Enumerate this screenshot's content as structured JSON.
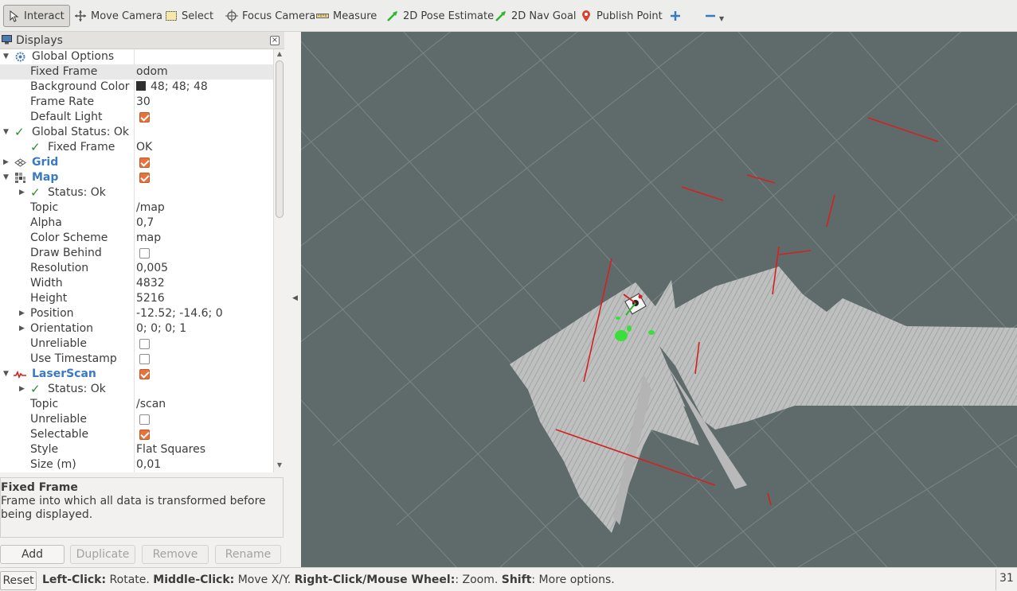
{
  "toolbar": {
    "interact": "Interact",
    "move_camera": "Move Camera",
    "select": "Select",
    "focus_camera": "Focus Camera",
    "measure": "Measure",
    "pose_estimate": "2D Pose Estimate",
    "nav_goal": "2D Nav Goal",
    "publish_point": "Publish Point"
  },
  "displays": {
    "title": "Displays",
    "rows": {
      "global_options": "Global Options",
      "fixed_frame": {
        "label": "Fixed Frame",
        "value": "odom"
      },
      "background_color": {
        "label": "Background Color",
        "value": "48; 48; 48"
      },
      "frame_rate": {
        "label": "Frame Rate",
        "value": "30"
      },
      "default_light": {
        "label": "Default Light",
        "checked": true
      },
      "global_status": "Global Status: Ok",
      "gs_fixed_frame": {
        "label": "Fixed Frame",
        "value": "OK"
      },
      "grid": {
        "label": "Grid",
        "checked": true
      },
      "map": {
        "label": "Map",
        "checked": true
      },
      "map_status": "Status: Ok",
      "map_topic": {
        "label": "Topic",
        "value": "/map"
      },
      "map_alpha": {
        "label": "Alpha",
        "value": "0,7"
      },
      "map_color_scheme": {
        "label": "Color Scheme",
        "value": "map"
      },
      "map_draw_behind": {
        "label": "Draw Behind",
        "checked": false
      },
      "map_resolution": {
        "label": "Resolution",
        "value": "0,005"
      },
      "map_width": {
        "label": "Width",
        "value": "4832"
      },
      "map_height": {
        "label": "Height",
        "value": "5216"
      },
      "map_position": {
        "label": "Position",
        "value": "-12.52; -14.6; 0"
      },
      "map_orientation": {
        "label": "Orientation",
        "value": "0; 0; 0; 1"
      },
      "map_unreliable": {
        "label": "Unreliable",
        "checked": false
      },
      "map_use_timestamp": {
        "label": "Use Timestamp",
        "checked": false
      },
      "laserscan": {
        "label": "LaserScan",
        "checked": true
      },
      "ls_status": "Status: Ok",
      "ls_topic": {
        "label": "Topic",
        "value": "/scan"
      },
      "ls_unreliable": {
        "label": "Unreliable",
        "checked": false
      },
      "ls_selectable": {
        "label": "Selectable",
        "checked": true
      },
      "ls_style": {
        "label": "Style",
        "value": "Flat Squares"
      },
      "ls_size": {
        "label": "Size (m)",
        "value": "0,01"
      }
    }
  },
  "description": {
    "title": "Fixed Frame",
    "text": "Frame into which all data is transformed before being displayed."
  },
  "buttons": {
    "add": "Add",
    "duplicate": "Duplicate",
    "remove": "Remove",
    "rename": "Rename"
  },
  "statusbar": {
    "reset": "Reset",
    "s1": "Left-Click:",
    "s2": " Rotate. ",
    "s3": "Middle-Click:",
    "s4": " Move X/Y. ",
    "s5": "Right-Click/Mouse Wheel:",
    "s6": ": Zoom. ",
    "s7": "Shift",
    "s8": ": More options.",
    "fps": "31"
  },
  "colors": {
    "viewport_bg": "#5f6b6b",
    "map_free": "#c9c9c9",
    "laser": "#d42020",
    "accent_blue": "#3a7ac4",
    "checkbox_on": "#e9723c"
  }
}
